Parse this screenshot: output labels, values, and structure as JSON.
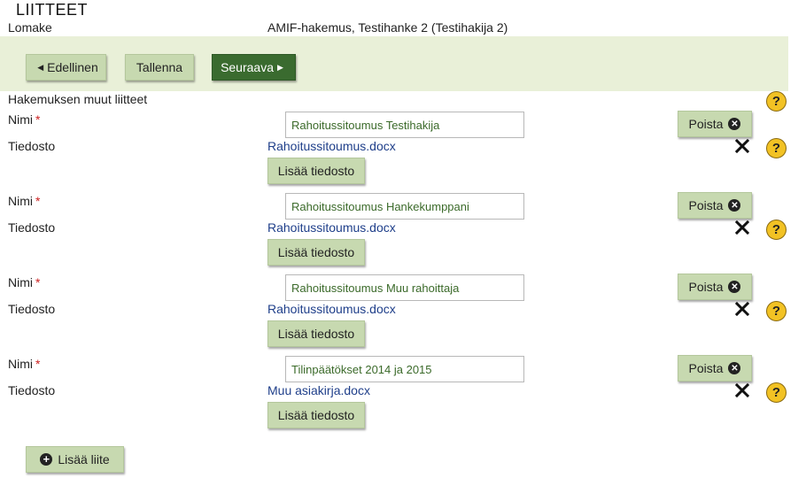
{
  "page": {
    "title": "LIITTEET",
    "form_label": "Lomake",
    "form_value": "AMIF-hakemus, Testihanke 2 (Testihakija 2)"
  },
  "nav": {
    "prev": "Edellinen",
    "save": "Tallenna",
    "next": "Seuraava"
  },
  "section": {
    "title": "Hakemuksen muut liitteet",
    "help": "?"
  },
  "labels": {
    "name": "Nimi",
    "required": "*",
    "file": "Tiedosto",
    "remove": "Poista",
    "add_file": "Lisää tiedosto"
  },
  "attachments": [
    {
      "name": "Rahoitussitoumus Testihakija",
      "file": "Rahoitussitoumus.docx"
    },
    {
      "name": "Rahoitussitoumus Hankekumppani",
      "file": "Rahoitussitoumus.docx"
    },
    {
      "name": "Rahoitussitoumus Muu rahoittaja",
      "file": "Rahoitussitoumus.docx"
    },
    {
      "name": "Tilinpäätökset 2014 ja 2015",
      "file": "Muu asiakirja.docx"
    }
  ],
  "add_attachment": "Lisää liite"
}
